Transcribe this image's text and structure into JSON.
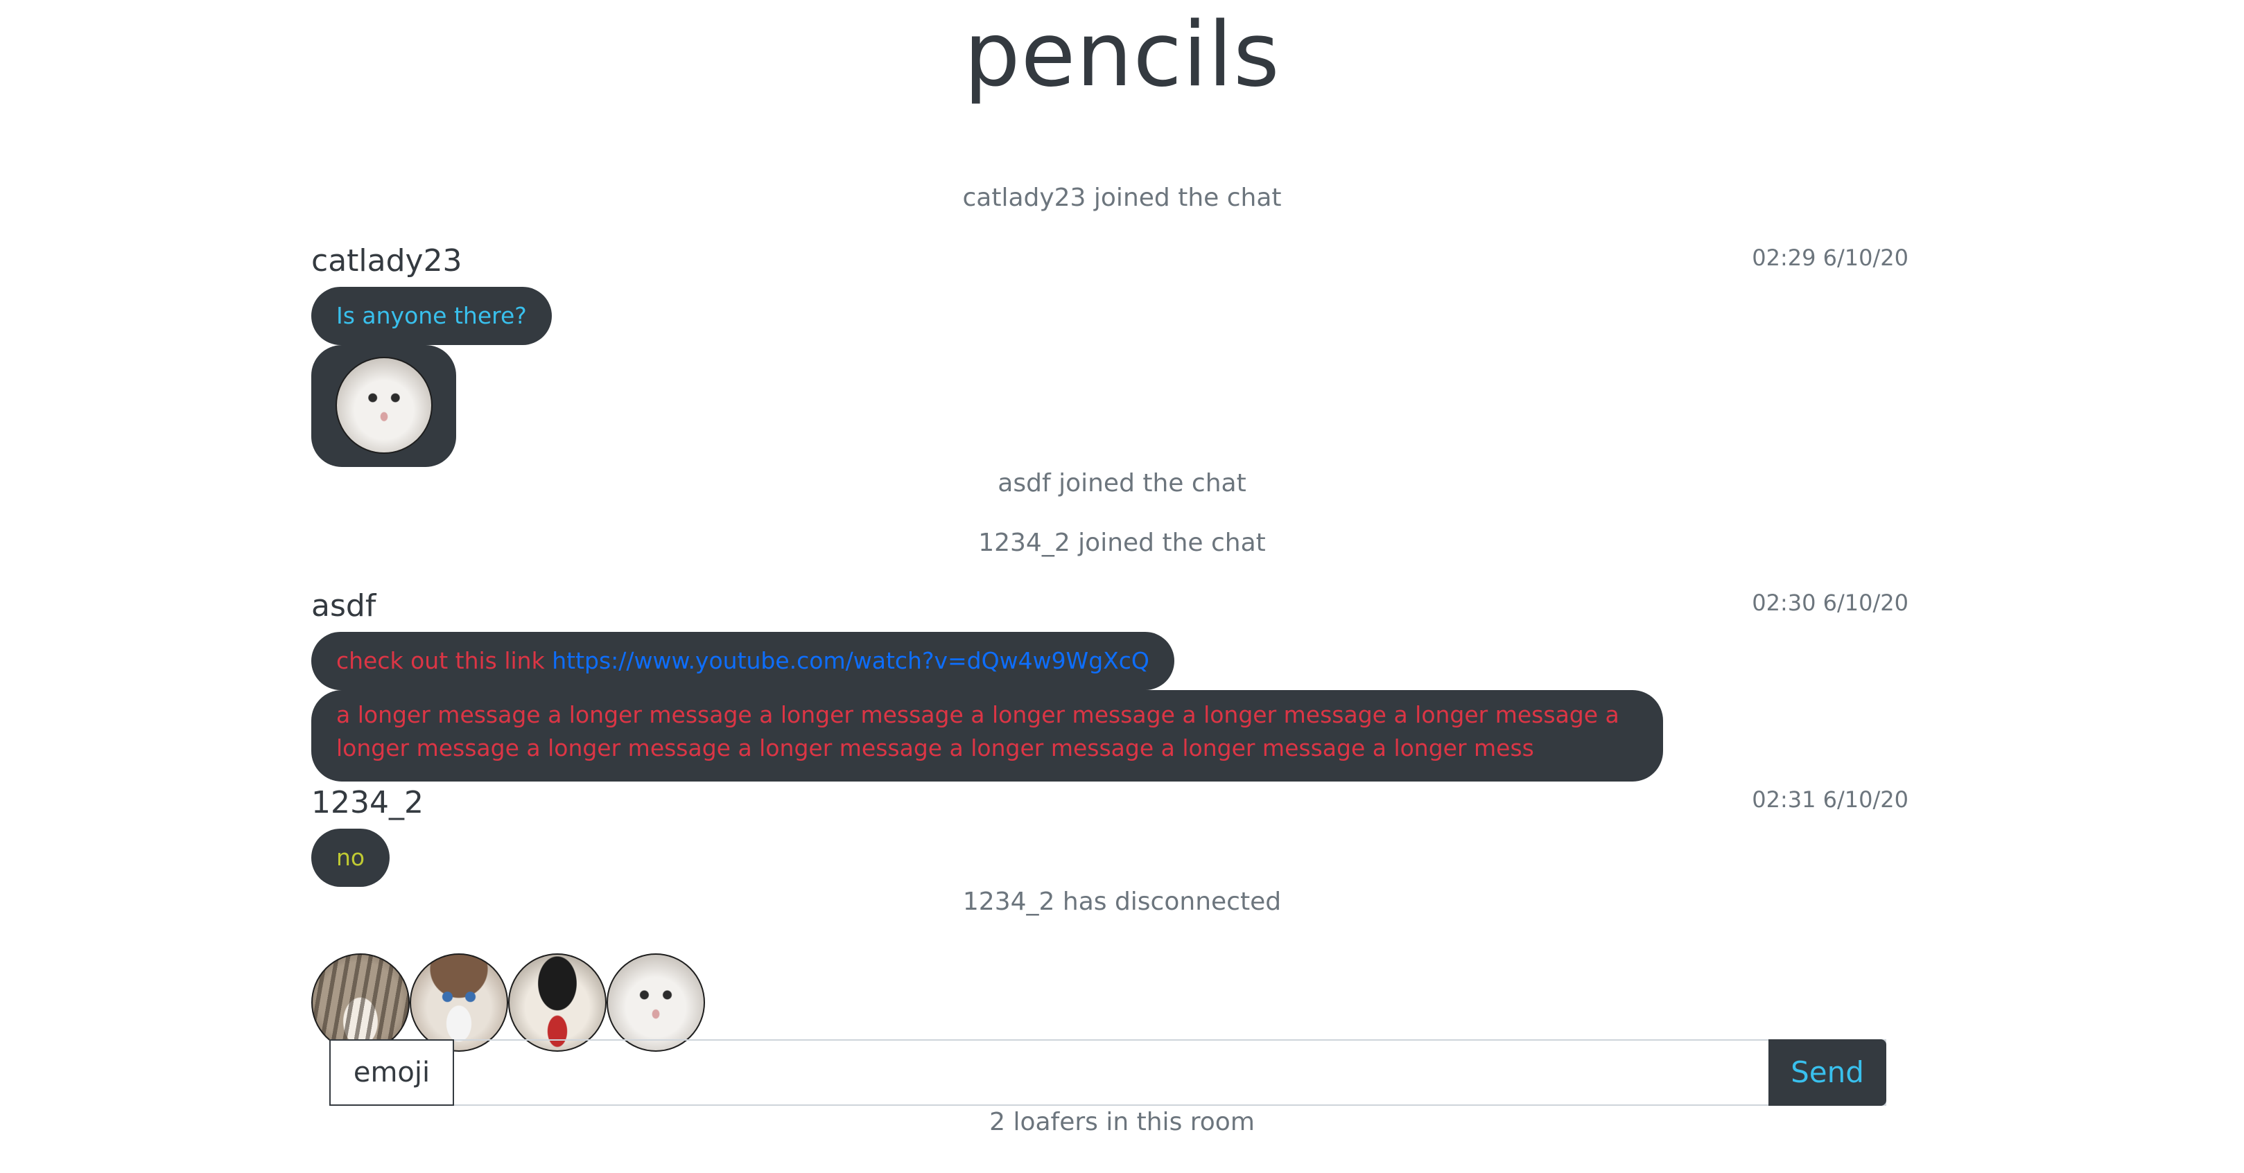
{
  "app": {
    "title": "pencils"
  },
  "colors": {
    "bubble_bg": "#343a40",
    "user_catlady23": "#39c0ed",
    "user_asdf": "#dc3545",
    "user_1234_2": "#c0ca33",
    "link": "#0d6efd",
    "system_text": "#6c757d"
  },
  "chat": {
    "events": [
      "catlady23 joined the chat",
      "asdf joined the chat",
      "1234_2 joined the chat",
      "1234_2 has disconnected"
    ],
    "groups": [
      {
        "user": "catlady23",
        "time": "02:29 6/10/20",
        "messages": [
          "Is anyone there?"
        ],
        "image_icon": "sad-cat-emoji-icon"
      },
      {
        "user": "asdf",
        "time": "02:30 6/10/20",
        "messages": [
          {
            "prefix": "check out this link",
            "link": "https://www.youtube.com/watch?v=dQw4w9WgXcQ"
          },
          "a longer message a longer message a longer message a longer message a longer message a longer message a longer message a longer message a longer message a longer message a longer message a longer mess"
        ]
      },
      {
        "user": "1234_2",
        "time": "02:31 6/10/20",
        "messages": [
          "no"
        ]
      }
    ]
  },
  "emoji_picker": {
    "icons": [
      "happy-cat-emoji-icon",
      "grumpy-cat-emoji-icon",
      "screaming-cat-emoji-icon",
      "sad-cat-emoji-icon"
    ]
  },
  "composer": {
    "emoji_label": "emoji",
    "input_value": "",
    "placeholder": "",
    "send_label": "Send"
  },
  "footer": {
    "room_count": "2 loafers in this room"
  }
}
